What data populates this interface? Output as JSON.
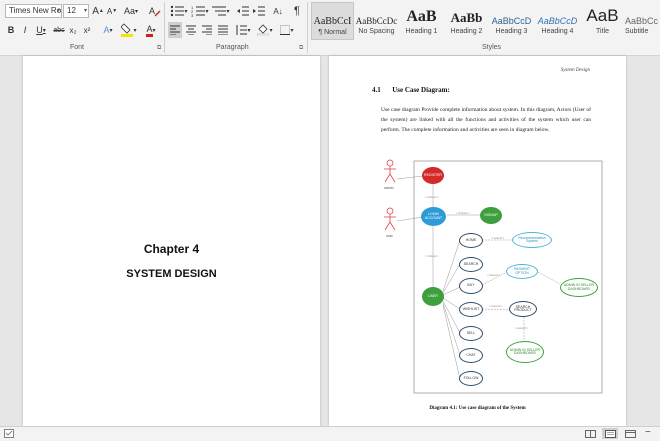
{
  "ribbon": {
    "font_group": {
      "label": "Font",
      "font_name": "Times New Ro",
      "font_size": "12",
      "grow_font": "A",
      "shrink_font": "A",
      "change_case": "Aa",
      "bold": "B",
      "italic": "I",
      "underline": "U",
      "strikethrough": "abc",
      "subscript": "x₂",
      "superscript": "x²",
      "text_effects": "A",
      "font_color": "A"
    },
    "paragraph_group": {
      "label": "Paragraph",
      "sort": "A↓",
      "show_marks": "¶"
    },
    "styles_group": {
      "label": "Styles",
      "items": [
        {
          "sample": "AaBbCcI",
          "name": "¶ Normal"
        },
        {
          "sample": "AaBbCcDc",
          "name": "No Spacing"
        },
        {
          "sample": "AaB",
          "name": "Heading 1"
        },
        {
          "sample": "AaBb",
          "name": "Heading 2"
        },
        {
          "sample": "AaBbCcD",
          "name": "Heading 3"
        },
        {
          "sample": "AaBbCcD",
          "name": "Heading 4"
        },
        {
          "sample": "AaB",
          "name": "Title"
        },
        {
          "sample": "AaBbCc",
          "name": "Subtitle"
        }
      ]
    }
  },
  "left_page": {
    "chapter": "Chapter 4",
    "title": "SYSTEM DESIGN"
  },
  "right_page": {
    "header": "System Design",
    "section_number": "4.1",
    "section_title": "Use Case Diagram:",
    "paragraph": "Use case diagram Provide complete information about system. In this diagram, Actors (User of the system) are linked with all the functions and activities of the system which user can perform. The complete information and activities are seen in diagram below.",
    "caption": "Diagram 4.1: Use case diagram of the System",
    "diagram": {
      "actors": [
        "admin",
        "user"
      ],
      "nodes": {
        "register": "REGISTER",
        "login": "LOGIN ACCOUNT",
        "signup": "SIGNUP",
        "home": "HOME",
        "recommendation": "Recommendation System",
        "search": "SEARCH",
        "buy": "BUY",
        "wishlist": "WISHLIST",
        "cart": "CART",
        "buying_confirm": "PAYMENT OPTION",
        "user_dash": "ADMIN IN SELLER DASHBOARD",
        "search_product": "SEARCH PRODUCT",
        "admin_dash": "ADMIN IN SELLER DASHBOARD",
        "user_center": "USER",
        "sell": "SELL",
        "chat": "CHAT",
        "follow": "FOLLOW"
      },
      "include_label": "<<include>>",
      "extend_label": "<<extend>>"
    }
  },
  "colors": {
    "red": "#d42a2a",
    "blue": "#2d9cd6",
    "green": "#3e9f3e",
    "light_blue": "#4fb3d9",
    "dark_outline": "#2c4a6b"
  }
}
